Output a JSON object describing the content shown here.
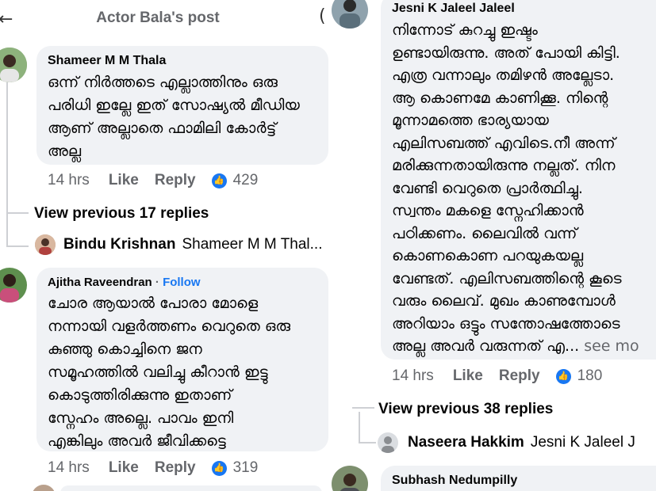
{
  "header": {
    "back_icon": "←",
    "title": "Actor Bala's post",
    "cut_icon": "("
  },
  "left": {
    "comment1": {
      "author": "Shameer M M Thala",
      "text": "ഒന്ന് നിർത്തടെ എല്ലാത്തിനും ഒരു\nപരിധി ഇല്ലേ ഇത് സോഷ്യൽ മീഡിയ\nആണ് അല്ലാതെ ഫാമിലി കോർട്ട്\nഅല്ല",
      "time": "14 hrs",
      "like": "Like",
      "reply": "Reply",
      "reactions": "429"
    },
    "view_previous": "View previous 17 replies",
    "reply_preview": {
      "name": "Bindu Krishnan",
      "text": "Shameer M M Thal..."
    },
    "comment2": {
      "author": "Ajitha Raveendran",
      "separator": "·",
      "follow": "Follow",
      "text": "ചോര ആയാൽ പോരാ മോളെ\nനന്നായി വളർത്തണം വെറുതെ ഒരു\nകുഞ്ഞു കൊച്ചിനെ ജന\nസമൂഹത്തിൽ വലിച്ചു കീറാൻ ഇട്ടു\nകൊടുത്തിരിക്കുന്നു ഇതാണ്\nസ്നേഹം അല്ലെ. പാവം ഇനി\nഎങ്കിലും അവർ ജീവിക്കട്ടെ",
      "time": "14 hrs",
      "like": "Like",
      "reply": "Reply",
      "reactions": "319"
    }
  },
  "right": {
    "comment1": {
      "author": "Jesni K Jaleel Jaleel",
      "text": "നിന്നോട് കുറച്ചു ഇഷ്ടം\nഉണ്ടായിരുന്നു. അത് പോയി കിട്ടി.\nഎത്ര വന്നാലും തമിഴൻ അല്ലേടാ.\nആ കൊണമേ കാണിക്കൂ. നിന്റെ\nമൂന്നാമത്തെ ഭാര്യയായ\nഎലിസബത്ത് എവിടെ.നീ അന്ന്\nമരിക്കുന്നതായിരുന്നു നല്ലത്. നിന\nവേണ്ടി വെറുതെ പ്രാർത്ഥിച്ചു.\nസ്വന്തം മകളെ സ്നേഹിക്കാൻ\nപഠിക്കണം. ലൈവിൽ വന്ന്\nകൊണകൊണ പറയുകയല്ല\nവേണ്ടത്. എലിസബത്തിന്റെ കൂടെ\nവരും ലൈവ്. മുഖം കാണുമ്പോൾ\nഅറിയാം ഒട്ടും സന്തോഷത്തോടെ\nഅല്ല അവർ വരുന്നത് എ...",
      "see_more": "see mo",
      "time": "14 hrs",
      "like": "Like",
      "reply": "Reply",
      "reactions": "180"
    },
    "view_previous": "View previous 38 replies",
    "reply_preview": {
      "name": "Naseera Hakkim",
      "text": "Jesni K Jaleel J"
    },
    "comment2": {
      "author": "Subhash Nedumpilly"
    }
  },
  "colors": {
    "bubble": "#f0f2f5",
    "meta": "#65676b",
    "brand": "#1877f2"
  }
}
